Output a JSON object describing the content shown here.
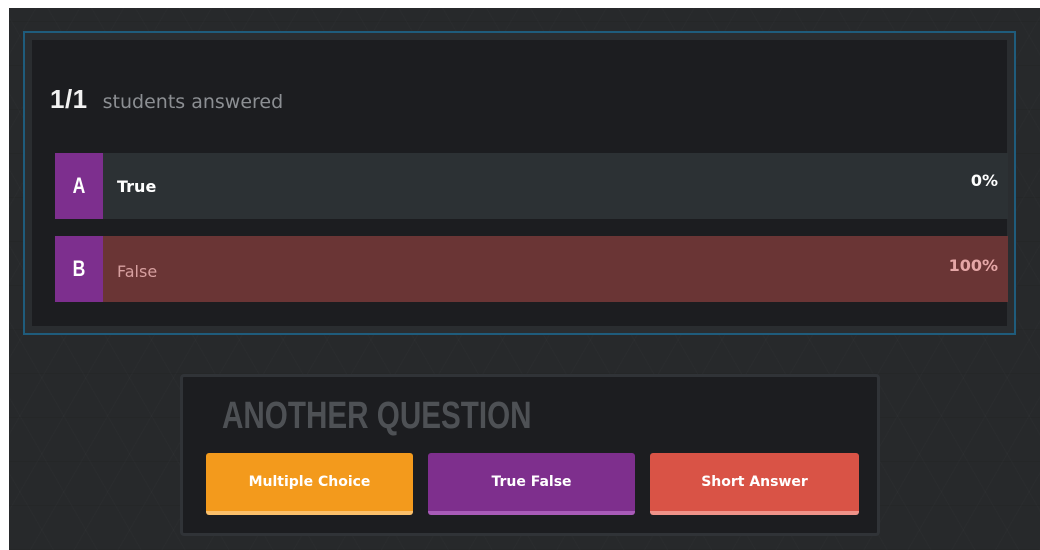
{
  "results": {
    "answered_count": "1/1",
    "answered_label": "students answered",
    "options": [
      {
        "letter": "A",
        "label": "True",
        "percent": "0%",
        "share": 0
      },
      {
        "letter": "B",
        "label": "False",
        "percent": "100%",
        "share": 1
      }
    ]
  },
  "another_question": {
    "title": "ANOTHER QUESTION",
    "buttons": {
      "multiple_choice": "Multiple Choice",
      "true_false": "True False",
      "short_answer": "Short Answer"
    }
  },
  "colors": {
    "panel_border": "#1f5c7c",
    "letter_badge": "#7d2f8e",
    "answer_fill": "#6a3535",
    "multiple_choice": "#f39a1c",
    "true_false": "#7e2f8d",
    "short_answer": "#d95346"
  }
}
